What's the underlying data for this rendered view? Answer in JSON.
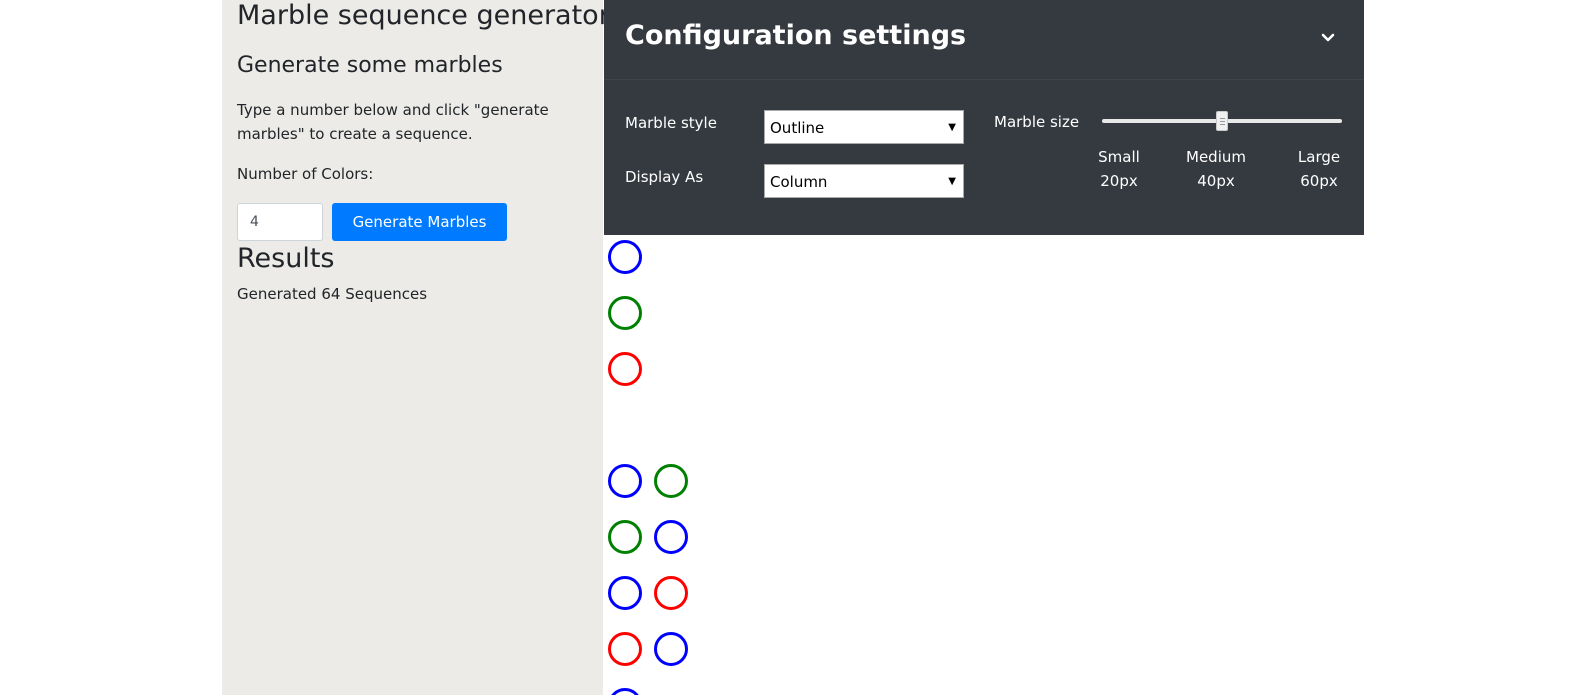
{
  "sidebar": {
    "app_title": "Marble sequence generator",
    "section_title": "Generate some marbles",
    "description": "Type a number below and click \"generate marbles\" to create a sequence.",
    "number_label": "Number of Colors:",
    "number_value": "4",
    "generate_button": "Generate Marbles",
    "results_title": "Results",
    "results_count": "Generated 64 Sequences"
  },
  "config": {
    "title": "Configuration settings",
    "marble_style_label": "Marble style",
    "marble_style_value": "Outline",
    "display_as_label": "Display As",
    "display_as_value": "Column",
    "marble_size_label": "Marble size",
    "marble_size_value": 40,
    "ticks": [
      {
        "name": "Small",
        "value": "20px"
      },
      {
        "name": "Medium",
        "value": "40px"
      },
      {
        "name": "Large",
        "value": "60px"
      }
    ]
  },
  "colors": {
    "blue": "#0000ff",
    "green": "#008000",
    "red": "#ff0000",
    "button": "#007bff",
    "panel": "#343a40",
    "sidebar": "#ecebe7"
  },
  "icons": {
    "collapse": "chevron-down-icon"
  },
  "sequences": [
    [
      "blue"
    ],
    [
      "green"
    ],
    [
      "red"
    ],
    [],
    [
      "blue",
      "green"
    ],
    [
      "green",
      "blue"
    ],
    [
      "blue",
      "red"
    ],
    [
      "red",
      "blue"
    ],
    [
      "blue"
    ]
  ]
}
